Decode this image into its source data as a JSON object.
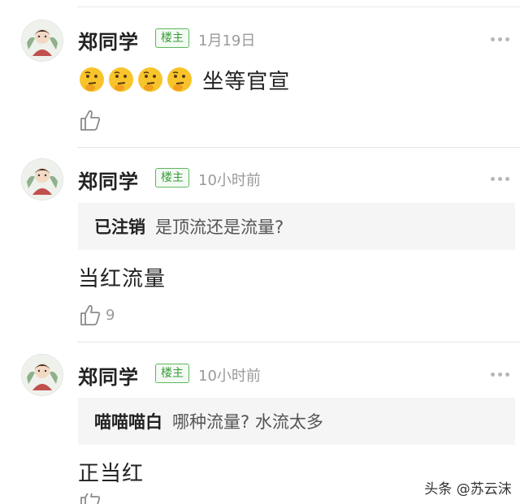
{
  "comments": [
    {
      "user": "郑同学",
      "badge": "楼主",
      "time": "1月19日",
      "emoji_count": 4,
      "emoji_icon": "thinking-face-icon",
      "text": "坐等官宣",
      "likes": ""
    },
    {
      "user": "郑同学",
      "badge": "楼主",
      "time": "10小时前",
      "quote_user": "已注销",
      "quote_text": "是顶流还是流量?",
      "text": "当红流量",
      "likes": "9"
    },
    {
      "user": "郑同学",
      "badge": "楼主",
      "time": "10小时前",
      "quote_user": "喵喵喵白",
      "quote_text": "哪种流量? 水流太多",
      "text": "正当红"
    }
  ],
  "watermark": "头条 @苏云沫",
  "colors": {
    "badge_green": "#5cb85c",
    "meta_gray": "#9a9a9a",
    "quote_bg": "#f5f5f5"
  }
}
